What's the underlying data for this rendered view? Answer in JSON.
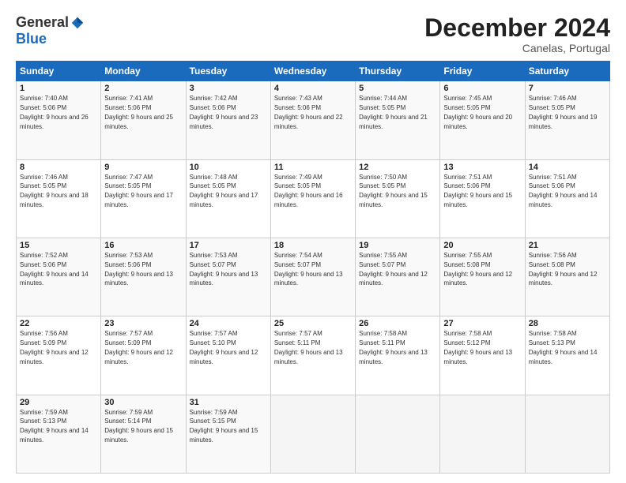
{
  "header": {
    "logo_general": "General",
    "logo_blue": "Blue",
    "month_title": "December 2024",
    "location": "Canelas, Portugal"
  },
  "weekdays": [
    "Sunday",
    "Monday",
    "Tuesday",
    "Wednesday",
    "Thursday",
    "Friday",
    "Saturday"
  ],
  "weeks": [
    [
      {
        "day": "1",
        "sunrise": "Sunrise: 7:40 AM",
        "sunset": "Sunset: 5:06 PM",
        "daylight": "Daylight: 9 hours and 26 minutes."
      },
      {
        "day": "2",
        "sunrise": "Sunrise: 7:41 AM",
        "sunset": "Sunset: 5:06 PM",
        "daylight": "Daylight: 9 hours and 25 minutes."
      },
      {
        "day": "3",
        "sunrise": "Sunrise: 7:42 AM",
        "sunset": "Sunset: 5:06 PM",
        "daylight": "Daylight: 9 hours and 23 minutes."
      },
      {
        "day": "4",
        "sunrise": "Sunrise: 7:43 AM",
        "sunset": "Sunset: 5:06 PM",
        "daylight": "Daylight: 9 hours and 22 minutes."
      },
      {
        "day": "5",
        "sunrise": "Sunrise: 7:44 AM",
        "sunset": "Sunset: 5:05 PM",
        "daylight": "Daylight: 9 hours and 21 minutes."
      },
      {
        "day": "6",
        "sunrise": "Sunrise: 7:45 AM",
        "sunset": "Sunset: 5:05 PM",
        "daylight": "Daylight: 9 hours and 20 minutes."
      },
      {
        "day": "7",
        "sunrise": "Sunrise: 7:46 AM",
        "sunset": "Sunset: 5:05 PM",
        "daylight": "Daylight: 9 hours and 19 minutes."
      }
    ],
    [
      {
        "day": "8",
        "sunrise": "Sunrise: 7:46 AM",
        "sunset": "Sunset: 5:05 PM",
        "daylight": "Daylight: 9 hours and 18 minutes."
      },
      {
        "day": "9",
        "sunrise": "Sunrise: 7:47 AM",
        "sunset": "Sunset: 5:05 PM",
        "daylight": "Daylight: 9 hours and 17 minutes."
      },
      {
        "day": "10",
        "sunrise": "Sunrise: 7:48 AM",
        "sunset": "Sunset: 5:05 PM",
        "daylight": "Daylight: 9 hours and 17 minutes."
      },
      {
        "day": "11",
        "sunrise": "Sunrise: 7:49 AM",
        "sunset": "Sunset: 5:05 PM",
        "daylight": "Daylight: 9 hours and 16 minutes."
      },
      {
        "day": "12",
        "sunrise": "Sunrise: 7:50 AM",
        "sunset": "Sunset: 5:05 PM",
        "daylight": "Daylight: 9 hours and 15 minutes."
      },
      {
        "day": "13",
        "sunrise": "Sunrise: 7:51 AM",
        "sunset": "Sunset: 5:06 PM",
        "daylight": "Daylight: 9 hours and 15 minutes."
      },
      {
        "day": "14",
        "sunrise": "Sunrise: 7:51 AM",
        "sunset": "Sunset: 5:06 PM",
        "daylight": "Daylight: 9 hours and 14 minutes."
      }
    ],
    [
      {
        "day": "15",
        "sunrise": "Sunrise: 7:52 AM",
        "sunset": "Sunset: 5:06 PM",
        "daylight": "Daylight: 9 hours and 14 minutes."
      },
      {
        "day": "16",
        "sunrise": "Sunrise: 7:53 AM",
        "sunset": "Sunset: 5:06 PM",
        "daylight": "Daylight: 9 hours and 13 minutes."
      },
      {
        "day": "17",
        "sunrise": "Sunrise: 7:53 AM",
        "sunset": "Sunset: 5:07 PM",
        "daylight": "Daylight: 9 hours and 13 minutes."
      },
      {
        "day": "18",
        "sunrise": "Sunrise: 7:54 AM",
        "sunset": "Sunset: 5:07 PM",
        "daylight": "Daylight: 9 hours and 13 minutes."
      },
      {
        "day": "19",
        "sunrise": "Sunrise: 7:55 AM",
        "sunset": "Sunset: 5:07 PM",
        "daylight": "Daylight: 9 hours and 12 minutes."
      },
      {
        "day": "20",
        "sunrise": "Sunrise: 7:55 AM",
        "sunset": "Sunset: 5:08 PM",
        "daylight": "Daylight: 9 hours and 12 minutes."
      },
      {
        "day": "21",
        "sunrise": "Sunrise: 7:56 AM",
        "sunset": "Sunset: 5:08 PM",
        "daylight": "Daylight: 9 hours and 12 minutes."
      }
    ],
    [
      {
        "day": "22",
        "sunrise": "Sunrise: 7:56 AM",
        "sunset": "Sunset: 5:09 PM",
        "daylight": "Daylight: 9 hours and 12 minutes."
      },
      {
        "day": "23",
        "sunrise": "Sunrise: 7:57 AM",
        "sunset": "Sunset: 5:09 PM",
        "daylight": "Daylight: 9 hours and 12 minutes."
      },
      {
        "day": "24",
        "sunrise": "Sunrise: 7:57 AM",
        "sunset": "Sunset: 5:10 PM",
        "daylight": "Daylight: 9 hours and 12 minutes."
      },
      {
        "day": "25",
        "sunrise": "Sunrise: 7:57 AM",
        "sunset": "Sunset: 5:11 PM",
        "daylight": "Daylight: 9 hours and 13 minutes."
      },
      {
        "day": "26",
        "sunrise": "Sunrise: 7:58 AM",
        "sunset": "Sunset: 5:11 PM",
        "daylight": "Daylight: 9 hours and 13 minutes."
      },
      {
        "day": "27",
        "sunrise": "Sunrise: 7:58 AM",
        "sunset": "Sunset: 5:12 PM",
        "daylight": "Daylight: 9 hours and 13 minutes."
      },
      {
        "day": "28",
        "sunrise": "Sunrise: 7:58 AM",
        "sunset": "Sunset: 5:13 PM",
        "daylight": "Daylight: 9 hours and 14 minutes."
      }
    ],
    [
      {
        "day": "29",
        "sunrise": "Sunrise: 7:59 AM",
        "sunset": "Sunset: 5:13 PM",
        "daylight": "Daylight: 9 hours and 14 minutes."
      },
      {
        "day": "30",
        "sunrise": "Sunrise: 7:59 AM",
        "sunset": "Sunset: 5:14 PM",
        "daylight": "Daylight: 9 hours and 15 minutes."
      },
      {
        "day": "31",
        "sunrise": "Sunrise: 7:59 AM",
        "sunset": "Sunset: 5:15 PM",
        "daylight": "Daylight: 9 hours and 15 minutes."
      },
      null,
      null,
      null,
      null
    ]
  ]
}
